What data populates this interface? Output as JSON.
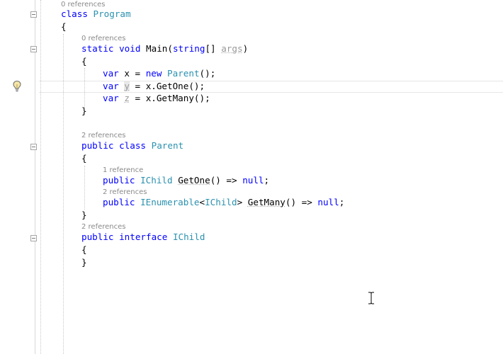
{
  "code_lens": {
    "program": "0 references",
    "main": "0 references",
    "parent_class": "2 references",
    "get_one": "1 reference",
    "get_many": "2 references",
    "ichild": "2 references"
  },
  "code": {
    "kw_class": "class",
    "program_name": "Program",
    "open_brace": "{",
    "close_brace": "}",
    "kw_static": "static",
    "kw_void": "void",
    "main_name": "Main",
    "main_params_open": "(",
    "kw_string": "string",
    "main_array": "[] ",
    "args": "args",
    "close_paren": ")",
    "kw_var": "var",
    "var_x": "x",
    "var_y": "y",
    "var_z": "z",
    "assign": " = ",
    "kw_new": "new",
    "new_parent_type": "Parent",
    "new_parent_tail": "();",
    "call_getone": "x.GetOne();",
    "call_getmany": "x.GetMany();",
    "kw_public": "public",
    "parent_name": "Parent",
    "ichild_type": "IChild",
    "getone_name": "GetOne",
    "arrow_null_prefix": "() => ",
    "kw_null": "null",
    "semicolon": ";",
    "ienumerable_type": "IEnumerable",
    "lt": "<",
    "gt": ">",
    "getmany_name": "GetMany",
    "kw_interface": "interface",
    "ichild_name": "IChild"
  },
  "icons": {
    "lightbulb": "lightbulb-icon",
    "collapse": "collapse-toggle-icon",
    "text_cursor": "i-beam-cursor-icon"
  }
}
